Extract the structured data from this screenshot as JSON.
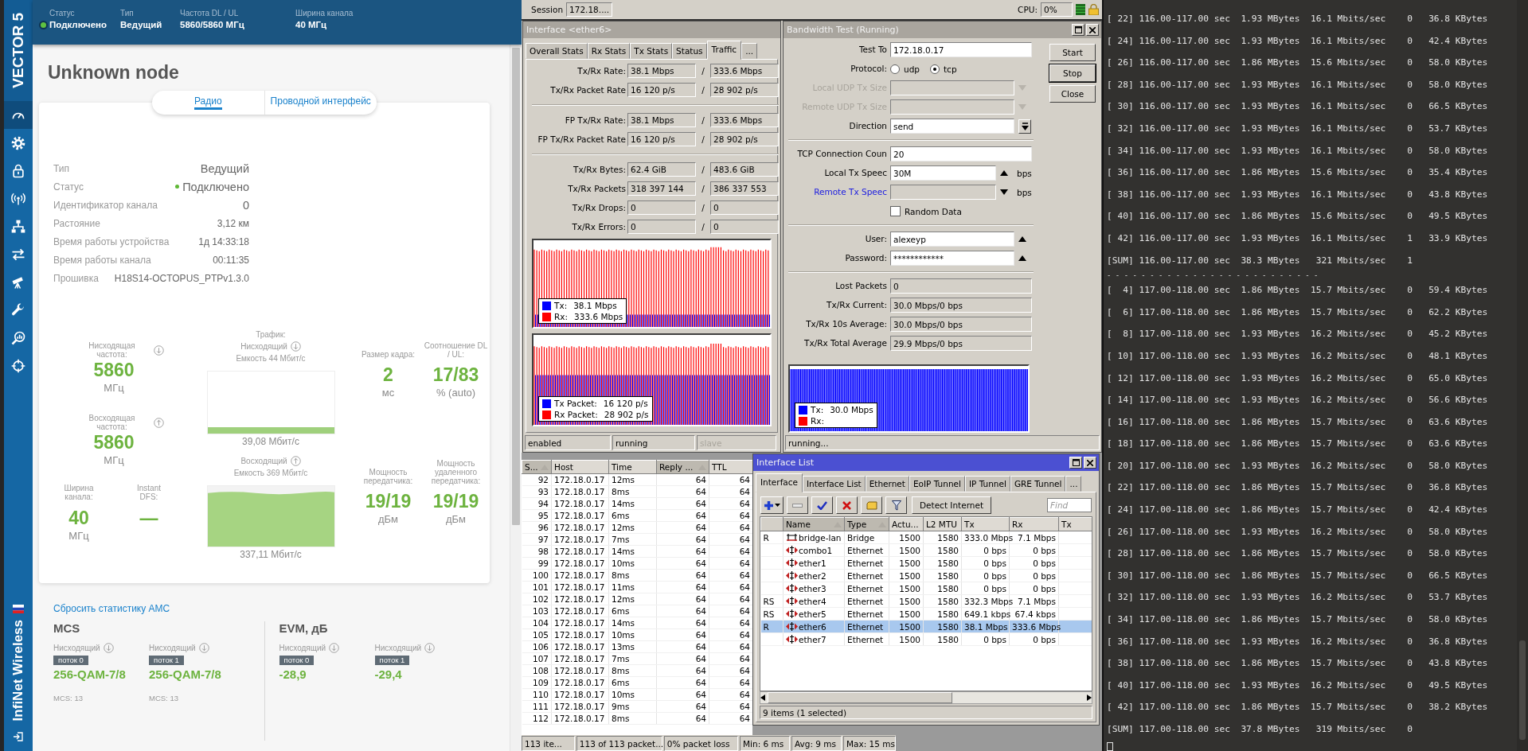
{
  "sidebar": {
    "logo": "VECTOR 5",
    "nav_items": [
      {
        "selected": true
      },
      {
        "selected": false
      },
      {
        "selected": false
      },
      {
        "selected": false
      },
      {
        "selected": false
      },
      {
        "selected": false
      },
      {
        "selected": false
      },
      {
        "selected": false
      },
      {
        "selected": false
      },
      {
        "selected": false
      }
    ],
    "brand": "InfiNet Wireless"
  },
  "header": {
    "fields": [
      {
        "kind": "status",
        "label": "Статус",
        "value": "Подключено"
      },
      {
        "kind": "text",
        "label": "Тип",
        "value": "Ведущий"
      },
      {
        "kind": "text",
        "label": "Частота DL / UL",
        "value": "5860/5860 МГц"
      },
      {
        "kind": "text",
        "label": "Ширина канала",
        "value": "40 МГц"
      }
    ]
  },
  "node_title": "Unknown node",
  "tabs": [
    {
      "label": "Радио",
      "selected": true
    },
    {
      "label": "Проводной интерфейс",
      "selected": false
    }
  ],
  "info": [
    {
      "kind": "text",
      "label": "Тип",
      "value": "Ведущий"
    },
    {
      "kind": "status",
      "label": "Статус",
      "value": "Подключено"
    },
    {
      "kind": "text",
      "label": "Идентификатор канала",
      "value": "0"
    },
    {
      "kind": "text",
      "label": "Растояние",
      "value": "3,12 км"
    },
    {
      "kind": "text",
      "label": "Время работы устройства",
      "value": "1д 14:33:18"
    },
    {
      "kind": "text",
      "label": "Время работы канала",
      "value": "00:11:35"
    },
    {
      "kind": "text",
      "label": "Прошивка",
      "value": "H18S14-OCTOPUS_PTPv1.3.0"
    }
  ],
  "stats": {
    "frequencies": [
      {
        "label": "Нисходящая частота:",
        "kind": "down",
        "value": "5860",
        "unit": "МГц"
      },
      {
        "label": "Восходящая частота:",
        "kind": "up",
        "value": "5860",
        "unit": "МГц"
      }
    ],
    "channel": [
      {
        "label": "Ширина канала:",
        "value": "40",
        "unit": "МГц"
      },
      {
        "label": "Instant DFS:",
        "value": "—"
      }
    ],
    "traffic": {
      "title": "Трафик:",
      "directions": [
        {
          "label": "Нисходящий",
          "kind": "down",
          "capacity": "Емкость 44 Мбит/с",
          "reading": "39,08 Мбит/с"
        },
        {
          "label": "Восходящий",
          "kind": "up",
          "capacity": "Емкость 369 Мбит/с",
          "reading": "337,11 Мбит/с"
        }
      ]
    },
    "frame": [
      {
        "label": "Размер кадра:",
        "value": "2",
        "unit": "мс"
      },
      {
        "label": "Соотношение DL / UL:",
        "value": "17/83",
        "unit": "% (auto)"
      }
    ],
    "power": [
      {
        "label": "Мощность передатчика:",
        "value": "19/19",
        "unit": "дБм"
      },
      {
        "label": "Мощность удаленного передатчика:",
        "value": "19/19",
        "unit": "дБм"
      }
    ]
  },
  "amc": {
    "reset_link": "Сбросить статистику АМС",
    "sections": [
      {
        "title": "MCS",
        "items": [
          {
            "direction": "Нисходящий",
            "stream": "поток 0",
            "value": "256-QAM-7/8",
            "note": "MCS: 13"
          },
          {
            "direction": "Нисходящий",
            "stream": "поток 1",
            "value": "256-QAM-7/8",
            "note": "MCS: 13"
          }
        ]
      },
      {
        "title": "EVM, дБ",
        "items": [
          {
            "direction": "Нисходящий",
            "stream": "поток 0",
            "value": "-28,9"
          },
          {
            "direction": "Нисходящий",
            "stream": "поток 1",
            "value": "-29,4"
          }
        ]
      }
    ]
  },
  "winbox": {
    "session_label": "Session",
    "session": "172.18....",
    "cpu_label": "CPU:",
    "cpu": "0%",
    "interface_window": {
      "title": "Interface <ether6>",
      "tabs": [
        {
          "label": "Overall Stats",
          "selected": false
        },
        {
          "label": "Rx Stats",
          "selected": false
        },
        {
          "label": "Tx Stats",
          "selected": false
        },
        {
          "label": "Status",
          "selected": false
        },
        {
          "label": "Traffic",
          "selected": true
        },
        {
          "label": "...",
          "selected": false
        }
      ],
      "sections": [
        [
          {
            "label": "Tx/Rx Rate:",
            "tx": "38.1 Mbps",
            "sep": "/",
            "rx": "333.6 Mbps"
          },
          {
            "label": "Tx/Rx Packet Rate",
            "tx": "16 120 p/s",
            "sep": "/",
            "rx": "28 902 p/s"
          }
        ],
        [
          {
            "label": "FP Tx/Rx Rate:",
            "tx": "38.1 Mbps",
            "sep": "/",
            "rx": "333.6 Mbps"
          },
          {
            "label": "FP Tx/Rx Packet Rate",
            "tx": "16 120 p/s",
            "sep": "/",
            "rx": "28 902 p/s"
          }
        ],
        [
          {
            "label": "Tx/Rx Bytes:",
            "tx": "62.4 GiB",
            "sep": "/",
            "rx": "483.6 GiB"
          },
          {
            "label": "Tx/Rx Packets",
            "tx": "318 397 144",
            "sep": "/",
            "rx": "386 337 553"
          },
          {
            "label": "Tx/Rx Drops:",
            "tx": "0",
            "sep": "/",
            "rx": "0"
          },
          {
            "label": "Tx/Rx Errors:",
            "tx": "0",
            "sep": "/",
            "rx": "0"
          }
        ]
      ],
      "graphs": [
        {
          "legend": [
            {
              "label": "Tx:",
              "value": "38.1 Mbps",
              "color": "#0000ff"
            },
            {
              "label": "Rx:",
              "value": "333.6 Mbps",
              "color": "#ff0000"
            }
          ]
        },
        {
          "legend": [
            {
              "label": "Tx Packet:",
              "value": "16 120 p/s",
              "color": "#0000ff"
            },
            {
              "label": "Rx Packet:",
              "value": "28 902 p/s",
              "color": "#ff0000"
            }
          ]
        }
      ],
      "status": [
        {
          "text": "enabled",
          "disabled": false
        },
        {
          "text": "running",
          "disabled": false
        },
        {
          "text": "slave",
          "disabled": true
        }
      ]
    },
    "bandwidth_window": {
      "title": "Bandwidth Test (Running)",
      "sections": [
        [
          {
            "kind": "input",
            "label": "Test To",
            "value": "172.18.0.17",
            "disabled": false,
            "linked": false
          },
          {
            "kind": "radio",
            "label": "Protocol:",
            "options": [
              {
                "label": "udp",
                "selected": false
              },
              {
                "label": "tcp",
                "selected": true
              }
            ],
            "disabled": false,
            "linked": false
          },
          {
            "kind": "dropdown",
            "label": "Local UDP Tx Size",
            "disabled": true,
            "linked": false
          },
          {
            "kind": "dropdown",
            "label": "Remote UDP Tx Size",
            "disabled": true,
            "linked": false
          },
          {
            "kind": "dropdown",
            "label": "Direction",
            "value": "send",
            "disabled": false,
            "linked": false
          }
        ],
        [
          {
            "kind": "input",
            "label": "TCP Connection Coun",
            "value": "20",
            "disabled": false,
            "linked": false
          },
          {
            "kind": "spin",
            "label": "Local Tx Speec",
            "value": "30M",
            "removable": true,
            "unit": "bps",
            "disabled": false,
            "linked": false
          },
          {
            "kind": "spin",
            "label": "Remote Tx Speec",
            "removable": false,
            "unit": "bps",
            "disabled": false,
            "linked": true
          },
          {
            "kind": "checkbox",
            "label": "Random Data",
            "checked": false,
            "disabled": false,
            "linked": false
          }
        ],
        [
          {
            "kind": "input",
            "label": "User:",
            "value": "alexeyp",
            "removable": true,
            "disabled": false,
            "linked": false
          },
          {
            "kind": "input",
            "label": "Password:",
            "value": "************",
            "removable": true,
            "disabled": false,
            "linked": false
          }
        ],
        [
          {
            "kind": "readonly",
            "label": "Lost Packets",
            "value": "0",
            "disabled": false,
            "linked": false
          },
          {
            "kind": "readonly",
            "label": "Tx/Rx Current:",
            "value": "30.0 Mbps/0 bps",
            "disabled": false,
            "linked": false
          },
          {
            "kind": "readonly",
            "label": "Tx/Rx 10s Average:",
            "value": "30.0 Mbps/0 bps",
            "disabled": false,
            "linked": false
          },
          {
            "kind": "readonly",
            "label": "Tx/Rx Total Average",
            "value": "29.9 Mbps/0 bps",
            "disabled": false,
            "linked": false
          }
        ]
      ],
      "buttons": [
        "Start",
        "Stop",
        "Close"
      ],
      "graph": {
        "legend": [
          {
            "label": "Tx:",
            "value": "30.0 Mbps",
            "color": "#0000ff"
          },
          {
            "label": "Rx:",
            "color": "#ff0000"
          }
        ]
      },
      "status": "running..."
    },
    "ping": {
      "columns": [
        {
          "label": "S...",
          "sorted": true
        },
        {
          "label": "Host",
          "sorted": false
        },
        {
          "label": "Time",
          "sorted": false
        },
        {
          "label": "Reply ...",
          "sorted": true
        },
        {
          "label": "TTL",
          "sorted": false
        }
      ],
      "rows": [
        [
          "92",
          "172.18.0.17",
          "12ms",
          "64",
          "64"
        ],
        [
          "93",
          "172.18.0.17",
          "8ms",
          "64",
          "64"
        ],
        [
          "94",
          "172.18.0.17",
          "14ms",
          "64",
          "64"
        ],
        [
          "95",
          "172.18.0.17",
          "6ms",
          "64",
          "64"
        ],
        [
          "96",
          "172.18.0.17",
          "12ms",
          "64",
          "64"
        ],
        [
          "97",
          "172.18.0.17",
          "7ms",
          "64",
          "64"
        ],
        [
          "98",
          "172.18.0.17",
          "14ms",
          "64",
          "64"
        ],
        [
          "99",
          "172.18.0.17",
          "10ms",
          "64",
          "64"
        ],
        [
          "100",
          "172.18.0.17",
          "8ms",
          "64",
          "64"
        ],
        [
          "101",
          "172.18.0.17",
          "11ms",
          "64",
          "64"
        ],
        [
          "102",
          "172.18.0.17",
          "12ms",
          "64",
          "64"
        ],
        [
          "103",
          "172.18.0.17",
          "6ms",
          "64",
          "64"
        ],
        [
          "104",
          "172.18.0.17",
          "14ms",
          "64",
          "64"
        ],
        [
          "105",
          "172.18.0.17",
          "10ms",
          "64",
          "64"
        ],
        [
          "106",
          "172.18.0.17",
          "13ms",
          "64",
          "64"
        ],
        [
          "107",
          "172.18.0.17",
          "7ms",
          "64",
          "64"
        ],
        [
          "108",
          "172.18.0.17",
          "8ms",
          "64",
          "64"
        ],
        [
          "109",
          "172.18.0.17",
          "6ms",
          "64",
          "64"
        ],
        [
          "110",
          "172.18.0.17",
          "10ms",
          "64",
          "64"
        ],
        [
          "111",
          "172.18.0.17",
          "9ms",
          "64",
          "64"
        ],
        [
          "112",
          "172.18.0.17",
          "8ms",
          "64",
          "64"
        ]
      ],
      "status": [
        "113 ite...",
        "113 of 113 packet...",
        "0% packet loss",
        "Min: 6 ms",
        "Avg: 9 ms",
        "Max: 15 ms"
      ]
    },
    "interface_list": {
      "title": "Interface List",
      "tabs": [
        {
          "label": "Interface",
          "selected": true
        },
        {
          "label": "Interface List",
          "selected": false
        },
        {
          "label": "Ethernet",
          "selected": false
        },
        {
          "label": "EoIP Tunnel",
          "selected": false
        },
        {
          "label": "IP Tunnel",
          "selected": false
        },
        {
          "label": "GRE Tunnel",
          "selected": false
        },
        {
          "label": "...",
          "selected": false
        }
      ],
      "detect_button": "Detect Internet",
      "find_placeholder": "Find",
      "columns": [
        {
          "label": "Name",
          "sorted": true
        },
        {
          "label": "Type",
          "sorted": true
        },
        {
          "label": "Actu...",
          "sorted": false
        },
        {
          "label": "L2 MTU",
          "sorted": false
        },
        {
          "label": "Tx",
          "sorted": false
        },
        {
          "label": "Rx",
          "sorted": false
        },
        {
          "label": "Tx",
          "sorted": false
        }
      ],
      "rows": [
        {
          "flags": "R",
          "kind": "bridge",
          "name": "bridge-lan",
          "type": "Bridge",
          "mtu": "1500",
          "l2mtu": "1580",
          "tx": "333.0 Mbps",
          "rx": "7.1 Mbps",
          "selected": false
        },
        {
          "kind": "ethernet",
          "name": "combo1",
          "type": "Ethernet",
          "mtu": "1500",
          "l2mtu": "1580",
          "tx": "0 bps",
          "rx": "0 bps",
          "selected": false
        },
        {
          "kind": "ethernet",
          "name": "ether1",
          "type": "Ethernet",
          "mtu": "1500",
          "l2mtu": "1580",
          "tx": "0 bps",
          "rx": "0 bps",
          "selected": false
        },
        {
          "kind": "ethernet",
          "name": "ether2",
          "type": "Ethernet",
          "mtu": "1500",
          "l2mtu": "1580",
          "tx": "0 bps",
          "rx": "0 bps",
          "selected": false
        },
        {
          "kind": "ethernet",
          "name": "ether3",
          "type": "Ethernet",
          "mtu": "1500",
          "l2mtu": "1580",
          "tx": "0 bps",
          "rx": "0 bps",
          "selected": false
        },
        {
          "flags": "RS",
          "kind": "ethernet",
          "name": "ether4",
          "type": "Ethernet",
          "mtu": "1500",
          "l2mtu": "1580",
          "tx": "332.3 Mbps",
          "rx": "7.1 Mbps",
          "selected": false
        },
        {
          "flags": "RS",
          "kind": "ethernet",
          "name": "ether5",
          "type": "Ethernet",
          "mtu": "1500",
          "l2mtu": "1580",
          "tx": "649.1 kbps",
          "rx": "67.4 kbps",
          "selected": false
        },
        {
          "flags": "R",
          "kind": "ethernet",
          "name": "ether6",
          "type": "Ethernet",
          "mtu": "1500",
          "l2mtu": "1580",
          "tx": "38.1 Mbps",
          "rx": "333.6 Mbps",
          "selected": true
        },
        {
          "kind": "ethernet",
          "name": "ether7",
          "type": "Ethernet",
          "mtu": "1500",
          "l2mtu": "1580",
          "tx": "0 bps",
          "rx": "0 bps",
          "selected": false
        }
      ],
      "status": "9 items (1 selected)"
    }
  },
  "terminal": {
    "lines": [
      {
        "kind": "output",
        "text": "[ 22] 116.00-117.00 sec  1.93 MBytes  16.1 Mbits/sec    0   36.8 KBytes"
      },
      {
        "kind": "output",
        "text": "[ 24] 116.00-117.00 sec  1.93 MBytes  16.1 Mbits/sec    0   42.4 KBytes"
      },
      {
        "kind": "output",
        "text": "[ 26] 116.00-117.00 sec  1.86 MBytes  15.6 Mbits/sec    0   58.0 KBytes"
      },
      {
        "kind": "output",
        "text": "[ 28] 116.00-117.00 sec  1.93 MBytes  16.1 Mbits/sec    0   58.0 KBytes"
      },
      {
        "kind": "output",
        "text": "[ 30] 116.00-117.00 sec  1.93 MBytes  16.1 Mbits/sec    0   66.5 KBytes"
      },
      {
        "kind": "output",
        "text": "[ 32] 116.00-117.00 sec  1.93 MBytes  16.1 Mbits/sec    0   53.7 KBytes"
      },
      {
        "kind": "output",
        "text": "[ 34] 116.00-117.00 sec  1.93 MBytes  16.1 Mbits/sec    0   58.0 KBytes"
      },
      {
        "kind": "output",
        "text": "[ 36] 116.00-117.00 sec  1.86 MBytes  15.6 Mbits/sec    0   35.4 KBytes"
      },
      {
        "kind": "output",
        "text": "[ 38] 116.00-117.00 sec  1.93 MBytes  16.1 Mbits/sec    0   43.8 KBytes"
      },
      {
        "kind": "output",
        "text": "[ 40] 116.00-117.00 sec  1.86 MBytes  15.6 Mbits/sec    0   49.5 KBytes"
      },
      {
        "kind": "output",
        "text": "[ 42] 116.00-117.00 sec  1.93 MBytes  16.1 Mbits/sec    1   33.9 KBytes"
      },
      {
        "kind": "output",
        "text": "[SUM] 116.00-117.00 sec  38.3 MBytes   321 Mbits/sec    1"
      },
      {
        "kind": "separator",
        "text": "- - - - - - - - - - - - - - - - - - - - - - - - -"
      },
      {
        "kind": "output",
        "text": "[  4] 117.00-118.00 sec  1.86 MBytes  15.7 Mbits/sec    0   59.4 KBytes"
      },
      {
        "kind": "output",
        "text": "[  6] 117.00-118.00 sec  1.86 MBytes  15.7 Mbits/sec    0   62.2 KBytes"
      },
      {
        "kind": "output",
        "text": "[  8] 117.00-118.00 sec  1.93 MBytes  16.2 Mbits/sec    0   45.2 KBytes"
      },
      {
        "kind": "output",
        "text": "[ 10] 117.00-118.00 sec  1.93 MBytes  16.2 Mbits/sec    0   48.1 KBytes"
      },
      {
        "kind": "output",
        "text": "[ 12] 117.00-118.00 sec  1.93 MBytes  16.2 Mbits/sec    0   65.0 KBytes"
      },
      {
        "kind": "output",
        "text": "[ 14] 117.00-118.00 sec  1.93 MBytes  16.2 Mbits/sec    0   56.6 KBytes"
      },
      {
        "kind": "output",
        "text": "[ 16] 117.00-118.00 sec  1.86 MBytes  15.7 Mbits/sec    0   63.6 KBytes"
      },
      {
        "kind": "output",
        "text": "[ 18] 117.00-118.00 sec  1.86 MBytes  15.7 Mbits/sec    0   63.6 KBytes"
      },
      {
        "kind": "output",
        "text": "[ 20] 117.00-118.00 sec  1.93 MBytes  16.2 Mbits/sec    0   58.0 KBytes"
      },
      {
        "kind": "output",
        "text": "[ 22] 117.00-118.00 sec  1.86 MBytes  15.7 Mbits/sec    0   36.8 KBytes"
      },
      {
        "kind": "output",
        "text": "[ 24] 117.00-118.00 sec  1.86 MBytes  15.7 Mbits/sec    0   42.4 KBytes"
      },
      {
        "kind": "output",
        "text": "[ 26] 117.00-118.00 sec  1.93 MBytes  16.2 Mbits/sec    0   58.0 KBytes"
      },
      {
        "kind": "output",
        "text": "[ 28] 117.00-118.00 sec  1.86 MBytes  15.7 Mbits/sec    0   58.0 KBytes"
      },
      {
        "kind": "output",
        "text": "[ 30] 117.00-118.00 sec  1.86 MBytes  15.7 Mbits/sec    0   66.5 KBytes"
      },
      {
        "kind": "output",
        "text": "[ 32] 117.00-118.00 sec  1.93 MBytes  16.2 Mbits/sec    0   53.7 KBytes"
      },
      {
        "kind": "output",
        "text": "[ 34] 117.00-118.00 sec  1.86 MBytes  15.7 Mbits/sec    0   58.0 KBytes"
      },
      {
        "kind": "output",
        "text": "[ 36] 117.00-118.00 sec  1.93 MBytes  16.2 Mbits/sec    0   36.8 KBytes"
      },
      {
        "kind": "output",
        "text": "[ 38] 117.00-118.00 sec  1.86 MBytes  15.7 Mbits/sec    0   43.8 KBytes"
      },
      {
        "kind": "output",
        "text": "[ 40] 117.00-118.00 sec  1.93 MBytes  16.2 Mbits/sec    0   49.5 KBytes"
      },
      {
        "kind": "output",
        "text": "[ 42] 117.00-118.00 sec  1.86 MBytes  15.7 Mbits/sec    0   38.2 KBytes"
      },
      {
        "kind": "output",
        "text": "[SUM] 117.00-118.00 sec  37.8 MBytes   319 Mbits/sec    0"
      }
    ]
  }
}
